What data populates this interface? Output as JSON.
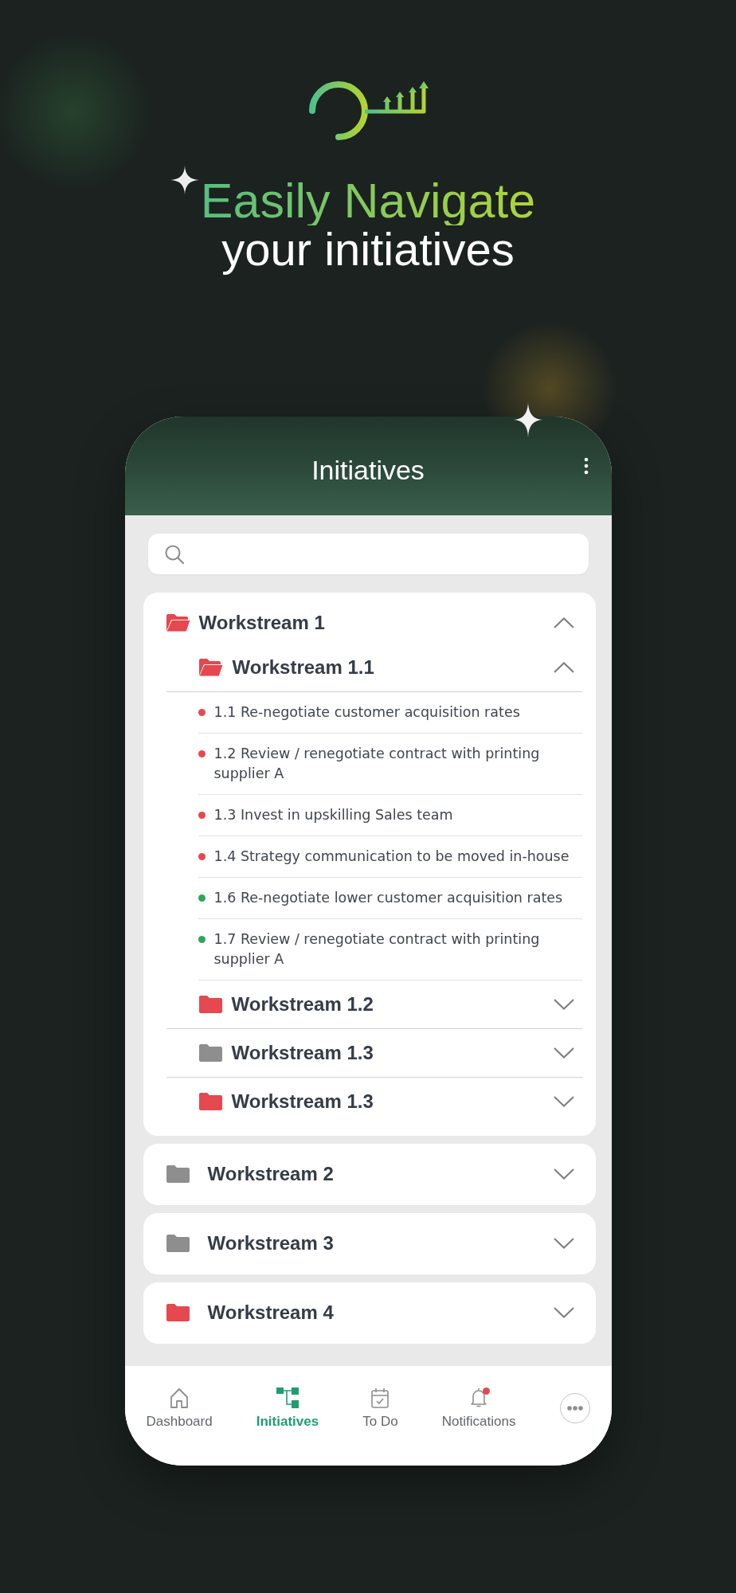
{
  "headline": {
    "title": "Easily Navigate",
    "subtitle": "your initiatives"
  },
  "app_bar": {
    "title": "Initiatives"
  },
  "workstreams": [
    {
      "label": "Workstream 1",
      "color": "#e5484f",
      "expanded": true,
      "children": [
        {
          "label": "Workstream 1.1",
          "color": "#e5484f",
          "expanded": true,
          "initiatives": [
            {
              "label": "1.1 Re-negotiate customer acquisition rates",
              "color": "#e5484f"
            },
            {
              "label": "1.2 Review / renegotiate contract with printing supplier A",
              "color": "#e5484f"
            },
            {
              "label": "1.3 Invest in upskilling Sales team",
              "color": "#e5484f"
            },
            {
              "label": "1.4 Strategy communication to be moved in-house",
              "color": "#e5484f"
            },
            {
              "label": "1.6 Re-negotiate lower customer acquisition rates",
              "color": "#2ea55a"
            },
            {
              "label": "1.7 Review / renegotiate contract with printing supplier A",
              "color": "#2ea55a"
            }
          ]
        },
        {
          "label": "Workstream 1.2",
          "color": "#e5484f",
          "expanded": false
        },
        {
          "label": "Workstream 1.3",
          "color": "#8e8e8e",
          "expanded": false
        },
        {
          "label": "Workstream 1.3",
          "color": "#e5484f",
          "expanded": false
        }
      ]
    },
    {
      "label": "Workstream 2",
      "color": "#8e8e8e",
      "expanded": false
    },
    {
      "label": "Workstream 3",
      "color": "#8e8e8e",
      "expanded": false
    },
    {
      "label": "Workstream 4",
      "color": "#e5484f",
      "expanded": false
    }
  ],
  "bottom_nav": [
    {
      "label": "Dashboard",
      "selected": false,
      "unread": false
    },
    {
      "label": "Initiatives",
      "selected": true,
      "unread": false
    },
    {
      "label": "To Do",
      "selected": false,
      "unread": false
    },
    {
      "label": "Notifications",
      "selected": false,
      "unread": true
    }
  ]
}
